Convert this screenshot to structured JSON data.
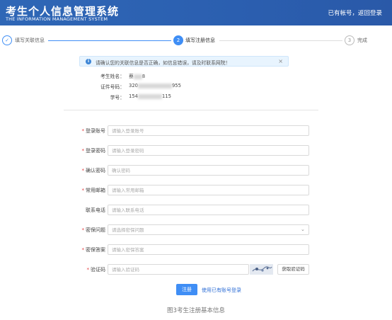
{
  "header": {
    "title_cn": "考生个人信息管理系统",
    "title_en": "THE INFORMATION MANAGEMENT SYSTEM",
    "has_account": "已有帐号，",
    "back_login": "返回登录",
    "bg_color": "#2f67b6"
  },
  "steps": [
    {
      "number": "✓",
      "label": "填写关联信息",
      "state": "done"
    },
    {
      "number": "2",
      "label": "填写注册信息",
      "state": "active"
    },
    {
      "number": "3",
      "label": "完成",
      "state": "todo"
    }
  ],
  "alert": {
    "icon": "info-icon",
    "text": "请确认您的关联信息是否正确，如信息错误，请及时联系网院！",
    "close": "×"
  },
  "student_info": [
    {
      "label": "考生姓名：",
      "value": "蔡",
      "value_tail": "8"
    },
    {
      "label": "证件号码：",
      "value": "320",
      "value_tail": "955"
    },
    {
      "label": "学号：",
      "value": "154",
      "value_tail": "115"
    }
  ],
  "form": {
    "fields": [
      {
        "label": "登录账号",
        "required": true,
        "placeholder": "请输入登录账号",
        "value": ""
      },
      {
        "label": "登录密码",
        "required": true,
        "placeholder": "请输入登录密码",
        "value": ""
      },
      {
        "label": "确认密码",
        "required": true,
        "placeholder": "确认密码",
        "value": ""
      },
      {
        "label": "常用邮箱",
        "required": true,
        "placeholder": "请输入常用邮箱",
        "value": ""
      },
      {
        "label": "联系电话",
        "required": false,
        "placeholder": "请输入联系电话",
        "value": ""
      },
      {
        "label": "密保问题",
        "required": true,
        "placeholder": "请选择密保问题",
        "value": ""
      },
      {
        "label": "密保答案",
        "required": true,
        "placeholder": "请输入密保答案",
        "value": ""
      },
      {
        "label": "验证码",
        "required": true,
        "placeholder": "请输入验证码",
        "value": ""
      }
    ],
    "captcha_button": "获取验证码",
    "submit": "注册",
    "login_link": "使用已有账号登录",
    "accent_color": "#3f8ef5",
    "required_color": "#e4393c"
  },
  "caption": "图3考生注册基本信息"
}
